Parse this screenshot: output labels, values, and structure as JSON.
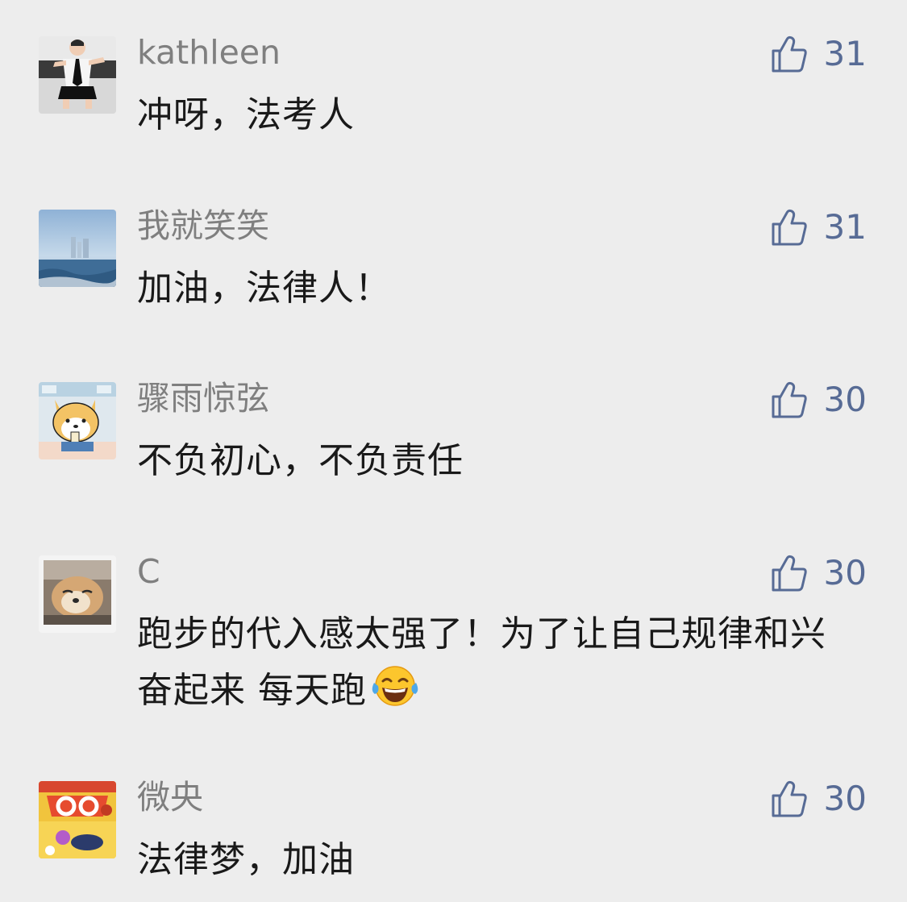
{
  "comments": [
    {
      "nickname": "kathleen",
      "content": "冲呀，法考人",
      "likes": "31",
      "avatar": "baby-photo-avatar"
    },
    {
      "nickname": "我就笑笑",
      "content": "加油，法律人！",
      "likes": "31",
      "avatar": "city-sea-avatar"
    },
    {
      "nickname": "骤雨惊弦",
      "content": "不负初心，不负责任",
      "likes": "30",
      "avatar": "cartoon-dog-avatar"
    },
    {
      "nickname": "C",
      "content": "跑步的代入感太强了！为了让自己规律和兴奋起来 每天跑",
      "likes": "30",
      "avatar": "shiba-dog-avatar",
      "emoji": "tears-of-joy-emoji"
    },
    {
      "nickname": "微央",
      "content": "法律梦，加油",
      "likes": "30",
      "avatar": "phonics-go-book-avatar"
    }
  ],
  "icons": {
    "like": "thumbs-up-icon"
  },
  "colors": {
    "background": "#ededed",
    "nickname": "#7f7f7f",
    "content": "#191919",
    "like": "#576b95"
  }
}
